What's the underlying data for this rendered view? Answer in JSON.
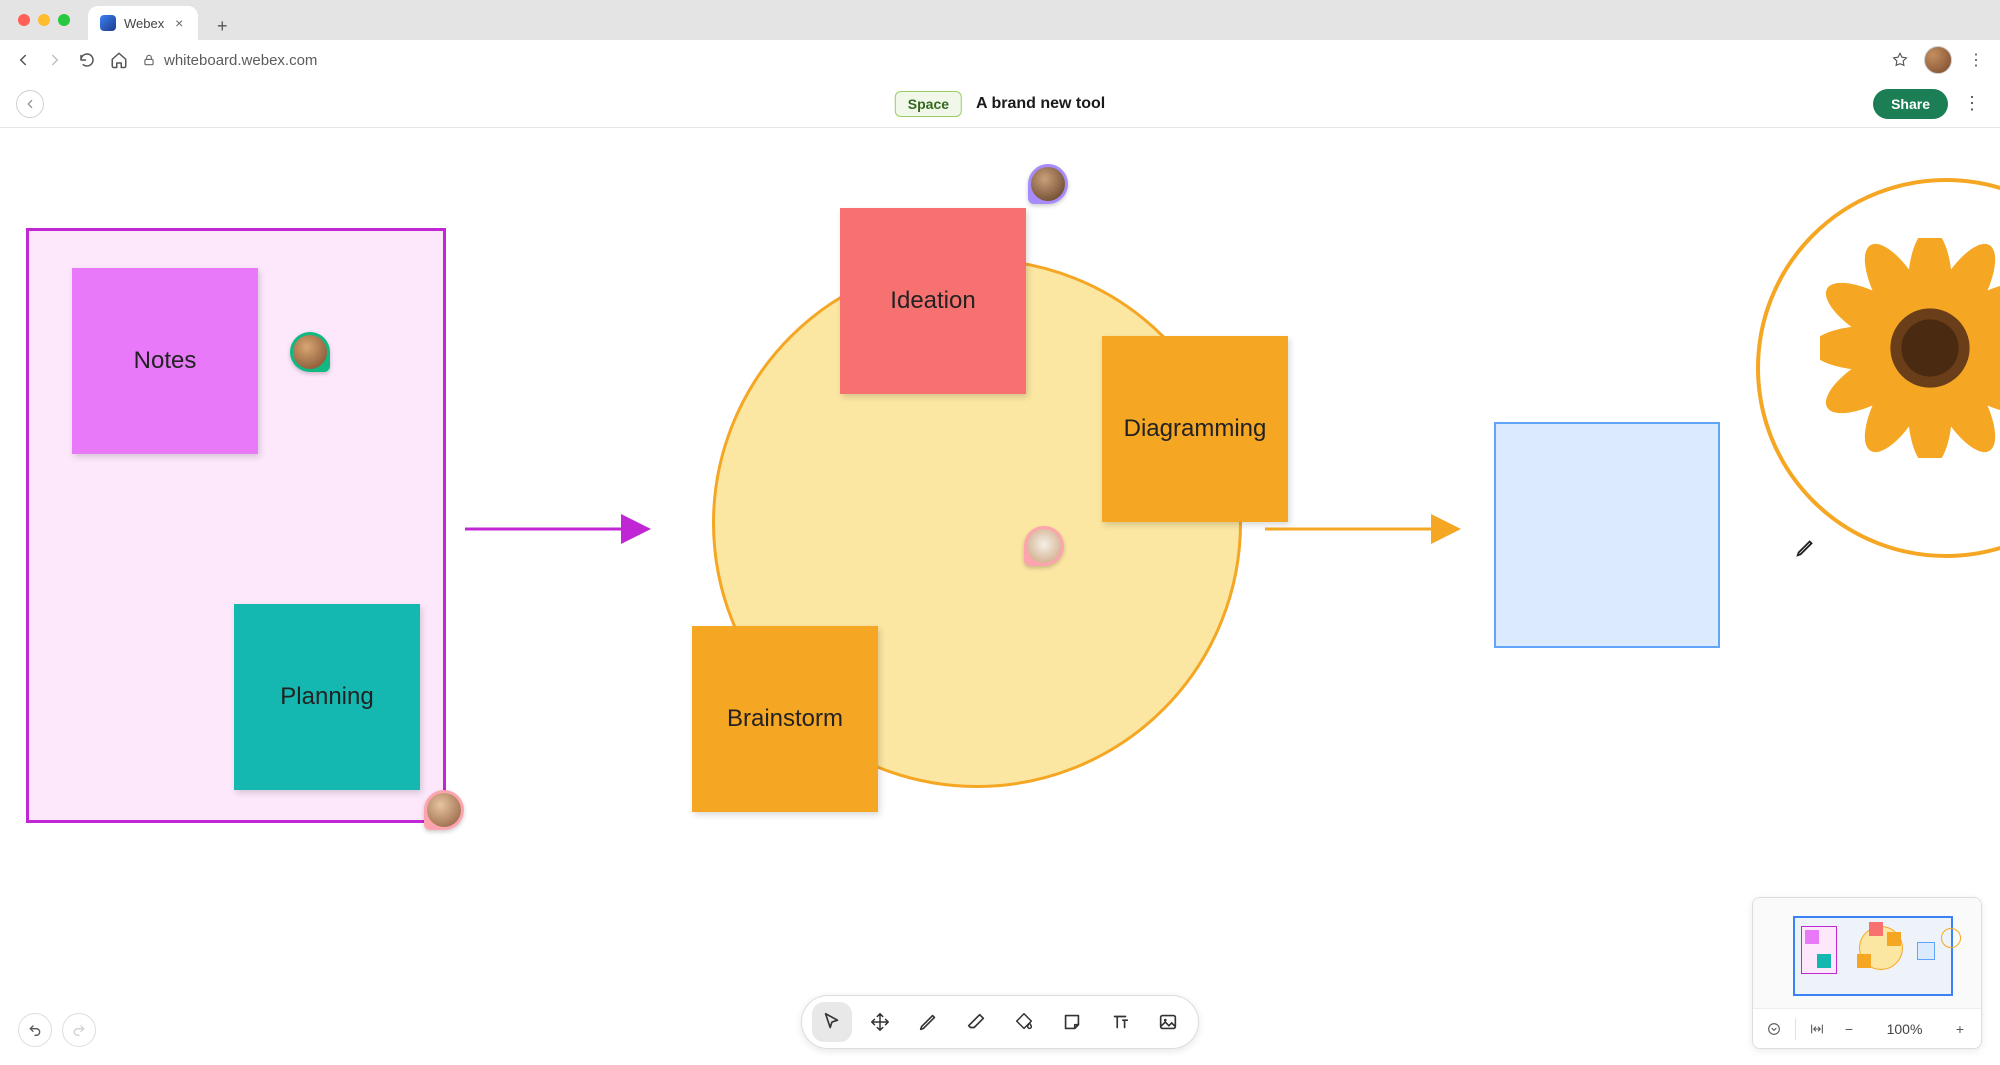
{
  "browser": {
    "tab_title": "Webex",
    "url": "whiteboard.webex.com"
  },
  "header": {
    "space_chip": "Space",
    "title": "A brand new tool",
    "share_label": "Share"
  },
  "notes": {
    "notes": "Notes",
    "planning": "Planning",
    "ideation": "Ideation",
    "diagramming": "Diagramming",
    "brainstorm": "Brainstorm"
  },
  "zoom": {
    "value": "100%"
  },
  "colors": {
    "purple_frame": "#c026d3",
    "orange": "#f5a623",
    "coral": "#f87171",
    "teal": "#14b8b0",
    "pink": "#e879f9",
    "blue_rect": "#60a5fa",
    "share_green": "#1b7e54"
  },
  "icons": {
    "select": "select-cursor",
    "move": "move-hand",
    "pen": "pen",
    "eraser": "eraser",
    "fill": "fill-bucket",
    "sticky": "sticky-note",
    "text": "text",
    "image": "image"
  }
}
